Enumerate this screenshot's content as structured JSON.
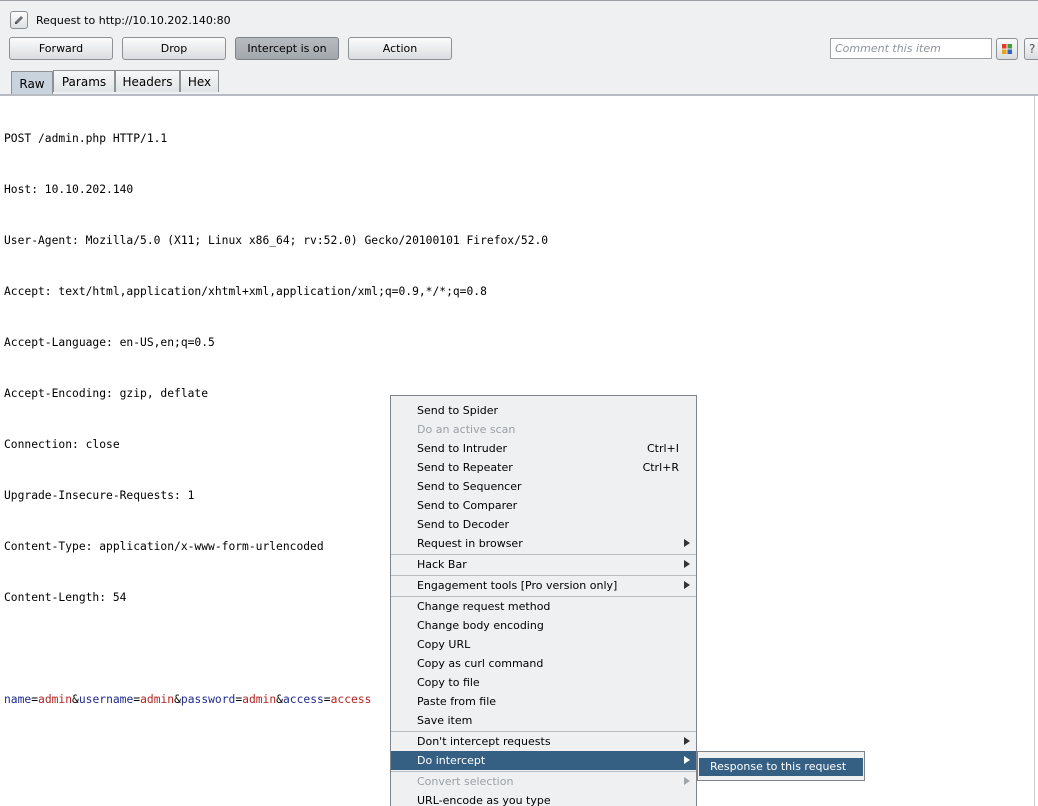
{
  "title": "Request to http://10.10.202.140:80",
  "toolbar": {
    "forward": "Forward",
    "drop": "Drop",
    "intercept": "Intercept is on",
    "action": "Action",
    "comment_placeholder": "Comment this item",
    "help": "?"
  },
  "tabs": [
    "Raw",
    "Params",
    "Headers",
    "Hex"
  ],
  "request": {
    "headers": [
      "POST /admin.php HTTP/1.1",
      "Host: 10.10.202.140",
      "User-Agent: Mozilla/5.0 (X11; Linux x86_64; rv:52.0) Gecko/20100101 Firefox/52.0",
      "Accept: text/html,application/xhtml+xml,application/xml;q=0.9,*/*;q=0.8",
      "Accept-Language: en-US,en;q=0.5",
      "Accept-Encoding: gzip, deflate",
      "Connection: close",
      "Upgrade-Insecure-Requests: 1",
      "Content-Type: application/x-www-form-urlencoded",
      "Content-Length: 54"
    ],
    "body_params": [
      {
        "name": "name",
        "value": "admin"
      },
      {
        "name": "username",
        "value": "admin"
      },
      {
        "name": "password",
        "value": "admin"
      },
      {
        "name": "access",
        "value": "access"
      }
    ]
  },
  "context_menu": {
    "items": [
      "Send to Spider",
      "Do an active scan",
      "Send to Intruder",
      "Send to Repeater",
      "Send to Sequencer",
      "Send to Comparer",
      "Send to Decoder",
      "Request in browser",
      "Hack Bar",
      "Engagement tools [Pro version only]",
      "Change request method",
      "Change body encoding",
      "Copy URL",
      "Copy as curl command",
      "Copy to file",
      "Paste from file",
      "Save item",
      "Don't intercept requests",
      "Do intercept",
      "Convert selection",
      "URL-encode as you type"
    ],
    "shortcuts": {
      "intruder": "Ctrl+I",
      "repeater": "Ctrl+R"
    },
    "submenu_item": "Response to this request"
  },
  "colors": {
    "highlight": "#365f84",
    "param_name": "#1f2b8c",
    "param_value": "#b22222"
  }
}
